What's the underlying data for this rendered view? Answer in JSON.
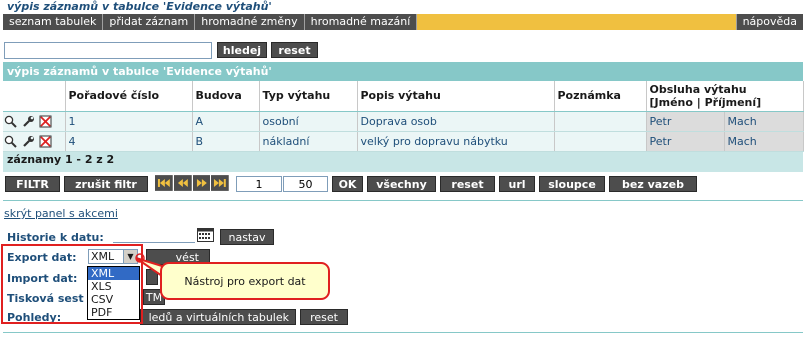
{
  "page_title": "výpis záznamů v tabulce 'Evidence výtahů'",
  "menu": {
    "items": [
      "seznam tabulek",
      "přidat záznam",
      "hromadné změny",
      "hromadné mazání"
    ],
    "help": "nápověda",
    "accent_color": "#f0c040"
  },
  "search": {
    "value": "",
    "search_button": "hledej",
    "reset_button": "reset"
  },
  "table": {
    "title": "výpis záznamů v tabulce 'Evidence výtahů'",
    "headers": {
      "order": "Pořadové číslo",
      "building": "Budova",
      "type": "Typ výtahu",
      "description": "Popis výtahu",
      "note": "Poznámka",
      "service": "Obsluha výtahu",
      "service_sub": "[Jméno | Příjmení]"
    },
    "row_icons": [
      "magnifier-icon",
      "wrench-icon",
      "delete-icon"
    ],
    "rows": [
      {
        "order": "1",
        "building": "A",
        "type": "osobní",
        "description": "Doprava osob",
        "note": "",
        "first_name": "Petr",
        "last_name": "Mach"
      },
      {
        "order": "4",
        "building": "B",
        "type": "nákladní",
        "description": "velký pro dopravu nábytku",
        "note": "",
        "first_name": "Petr",
        "last_name": "Mach"
      }
    ],
    "footer": "záznamy 1 - 2 z 2"
  },
  "pager": {
    "filter_button": "FILTR",
    "clear_filter_button": "zrušit filtr",
    "nav_icons": [
      "first-page-icon",
      "prev-page-icon",
      "next-page-icon",
      "last-page-icon"
    ],
    "page_value": "1",
    "per_page_value": "50",
    "ok_button": "OK",
    "all_button": "všechny",
    "reset_button": "reset",
    "url_button": "url",
    "columns_button": "sloupce",
    "no_links_button": "bez vazeb"
  },
  "actions": {
    "hide_panel_link": "skrýt panel s akcemi",
    "history_label": "Historie k datu:",
    "history_value": "",
    "set_button": "nastav",
    "export_label": "Export dat:",
    "export_selected": "XML",
    "export_options": [
      "XML",
      "XLS",
      "CSV",
      "PDF"
    ],
    "export_button_partial": "vést",
    "import_label": "Import dat:",
    "print_label_partial": "Tisková sest",
    "print_button_partial": "TM",
    "views_label": "Pohledy:",
    "views_button_partial": "ledů a virtuálních tabulek",
    "views_reset": "reset",
    "tooltip": "Nástroj pro export dat",
    "highlight_color": "#e02020"
  }
}
